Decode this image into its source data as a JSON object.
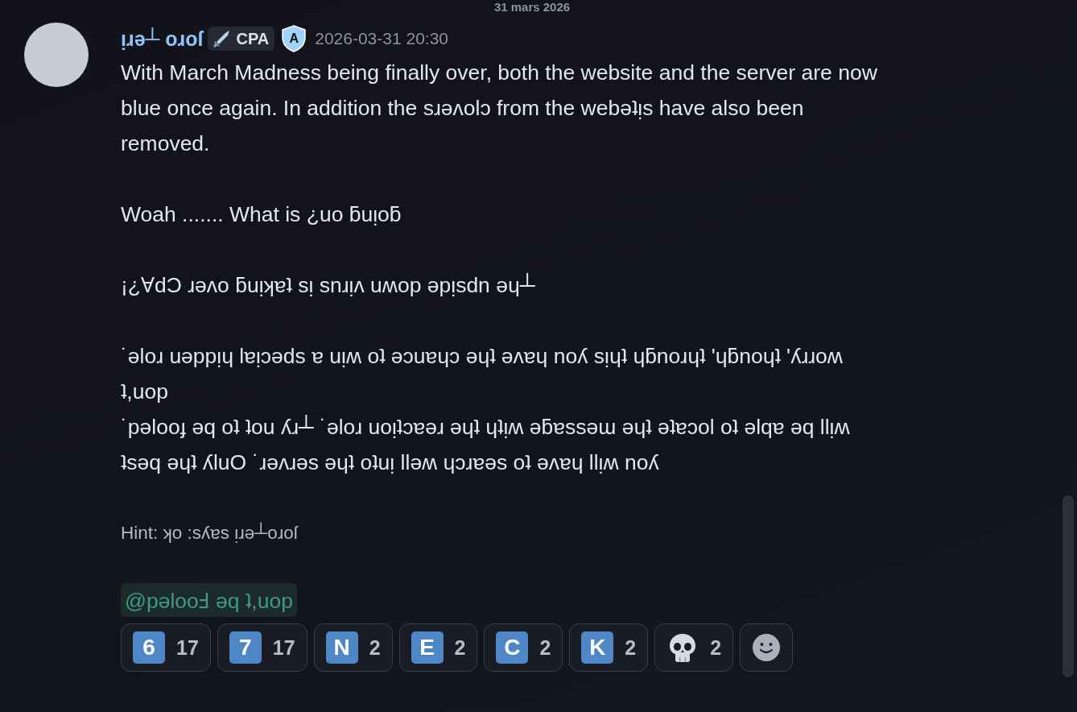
{
  "date_divider": "31 mars 2026",
  "message": {
    "author": "ᴉɹǝ┴ oɹoſ",
    "tag": "CPA",
    "role_letter": "A",
    "timestamp": "2026-03-31 20:30",
    "paragraphs": [
      "With March Madness being finally over, both the website and the server are now\nblue once again. In addition the sɹǝʌolɔ from the webǝʇᴉs have also been\nremoved.",
      "Woah ....... What is ¿uo ƃuᴉoƃ",
      "¡¿ⱯdƆ ɹǝʌo ƃuᴉʞɐʇ sᴉ snɹᴉʌ uʍop ǝpᴉsdn ǝɥ┴",
      "˙ǝloɹ uǝppᴉɥ lɐᴉɔǝds ɐ uᴉʍ oʇ ǝɔuɐɥɔ ǝɥʇ ǝʌɐɥ noʎ sᴉɥʇ ɥƃnoɹɥʇ 'ɥƃnoɥʇ 'ʎɹɹoʍ\nʇ,uop\n˙pǝlooɟ ǝq oʇ ʇou ʎɹ┴ ˙ǝloɹ uoᴉʇɔɐǝɹ ǝɥʇ ɥʇᴉʍ ǝƃɐssǝɯ ǝɥʇ ǝʇɐɔol oʇ ǝlqɐ ǝq llᴉʍ\nʇsǝq ǝɥʇ ʎluO ˙ɹǝʌɹǝs ǝɥʇ oʇuᴉ llǝʍ ɥɔɹɐǝs oʇ ǝʌɐɥ llᴉʍ noʎ"
    ],
    "hint": "Hint: ʞo :sʎɐs ᴉɹǝ┴oɹoſ",
    "mention": "@pǝlooℲ ǝq ʇ,uop",
    "reactions": [
      {
        "kind": "letter",
        "glyph": "6",
        "count": "17"
      },
      {
        "kind": "letter",
        "glyph": "7",
        "count": "17"
      },
      {
        "kind": "letter",
        "glyph": "N",
        "count": "2"
      },
      {
        "kind": "letter",
        "glyph": "E",
        "count": "2"
      },
      {
        "kind": "letter",
        "glyph": "C",
        "count": "2"
      },
      {
        "kind": "letter",
        "glyph": "K",
        "count": "2"
      },
      {
        "kind": "skull",
        "count": "2"
      }
    ]
  }
}
